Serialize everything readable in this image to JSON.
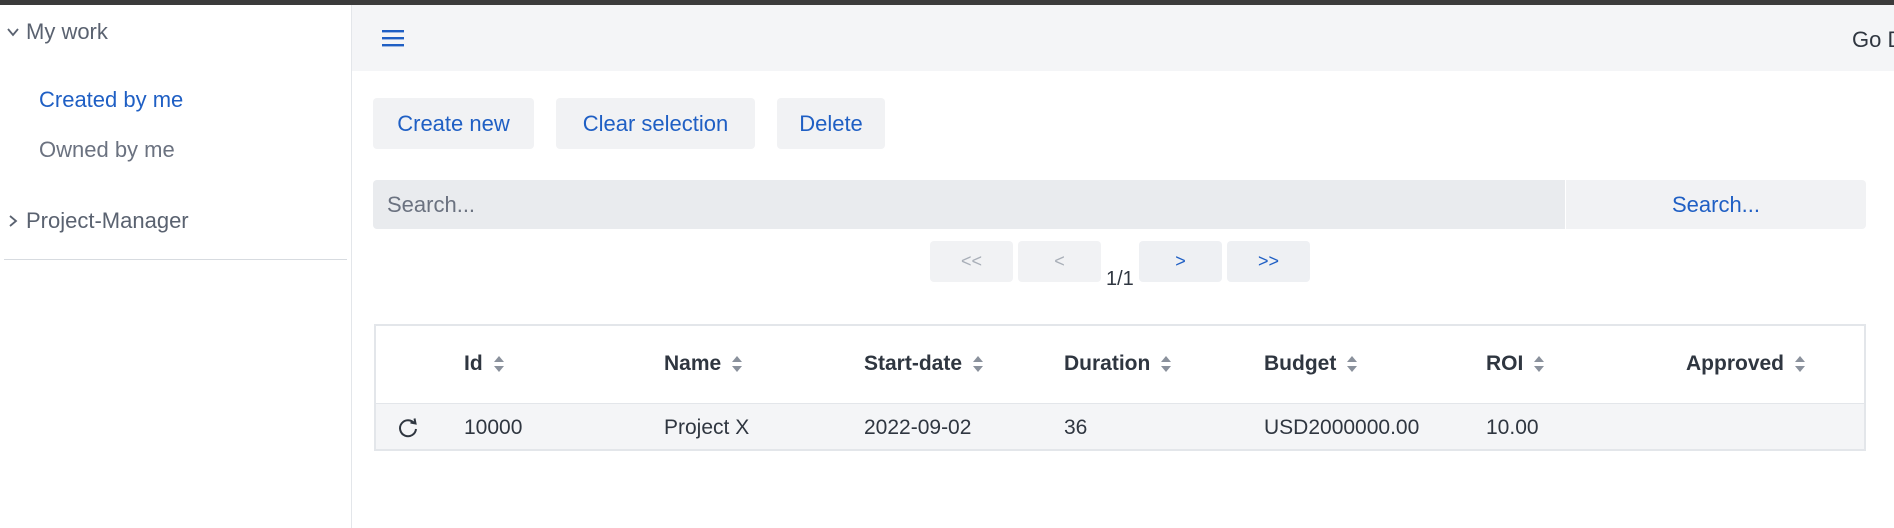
{
  "sidebar": {
    "groups": [
      {
        "label": "My work",
        "expanded": true
      },
      {
        "label": "Project-Manager",
        "expanded": false
      }
    ],
    "items": [
      {
        "label": "Created by me",
        "active": true
      },
      {
        "label": "Owned by me",
        "active": false
      }
    ]
  },
  "header": {
    "menu_icon": "hamburger-icon",
    "right_text": "Go D"
  },
  "toolbar": {
    "create_label": "Create new",
    "clear_label": "Clear selection",
    "delete_label": "Delete"
  },
  "search": {
    "placeholder": "Search...",
    "value": "",
    "button_label": "Search..."
  },
  "pagination": {
    "first": "<<",
    "prev": "<",
    "next": ">",
    "last": ">>",
    "indicator": "1/1"
  },
  "table": {
    "columns": [
      "Id",
      "Name",
      "Start-date",
      "Duration",
      "Budget",
      "ROI",
      "Approved"
    ],
    "rows": [
      {
        "id": "10000",
        "name": "Project X",
        "start_date": "2022-09-02",
        "duration": "36",
        "budget": "USD2000000.00",
        "roi": "10.00",
        "approved": ""
      }
    ]
  },
  "colors": {
    "accent": "#1f5fc4",
    "header_bg": "#f4f5f7",
    "button_bg": "#f1f2f4",
    "text": "#2f3640"
  }
}
